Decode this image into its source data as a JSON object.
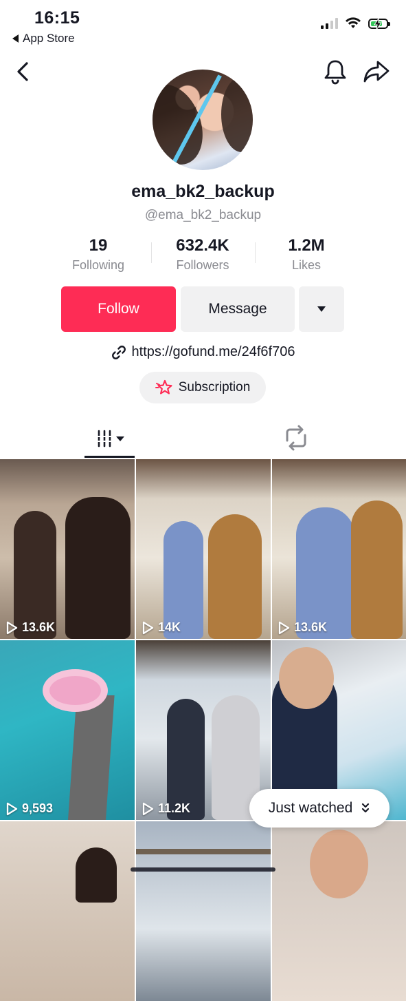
{
  "status_bar": {
    "time": "16:15",
    "back_app": "App Store"
  },
  "profile": {
    "username": "ema_bk2_backup",
    "handle": "@ema_bk2_backup",
    "stats": [
      {
        "value": "19",
        "label": "Following"
      },
      {
        "value": "632.4K",
        "label": "Followers"
      },
      {
        "value": "1.2M",
        "label": "Likes"
      }
    ],
    "follow_label": "Follow",
    "message_label": "Message",
    "link": "https://gofund.me/24f6f706",
    "subscription_label": "Subscription"
  },
  "videos": [
    {
      "views": "13.6K"
    },
    {
      "views": "14K"
    },
    {
      "views": "13.6K"
    },
    {
      "views": "9,593"
    },
    {
      "views": "11.2K"
    },
    {
      "views": ""
    },
    {
      "views": ""
    },
    {
      "views": ""
    },
    {
      "views": ""
    }
  ],
  "just_watched_label": "Just watched",
  "colors": {
    "accent": "#fe2c55",
    "text": "#161823",
    "muted": "#8a8b91"
  }
}
